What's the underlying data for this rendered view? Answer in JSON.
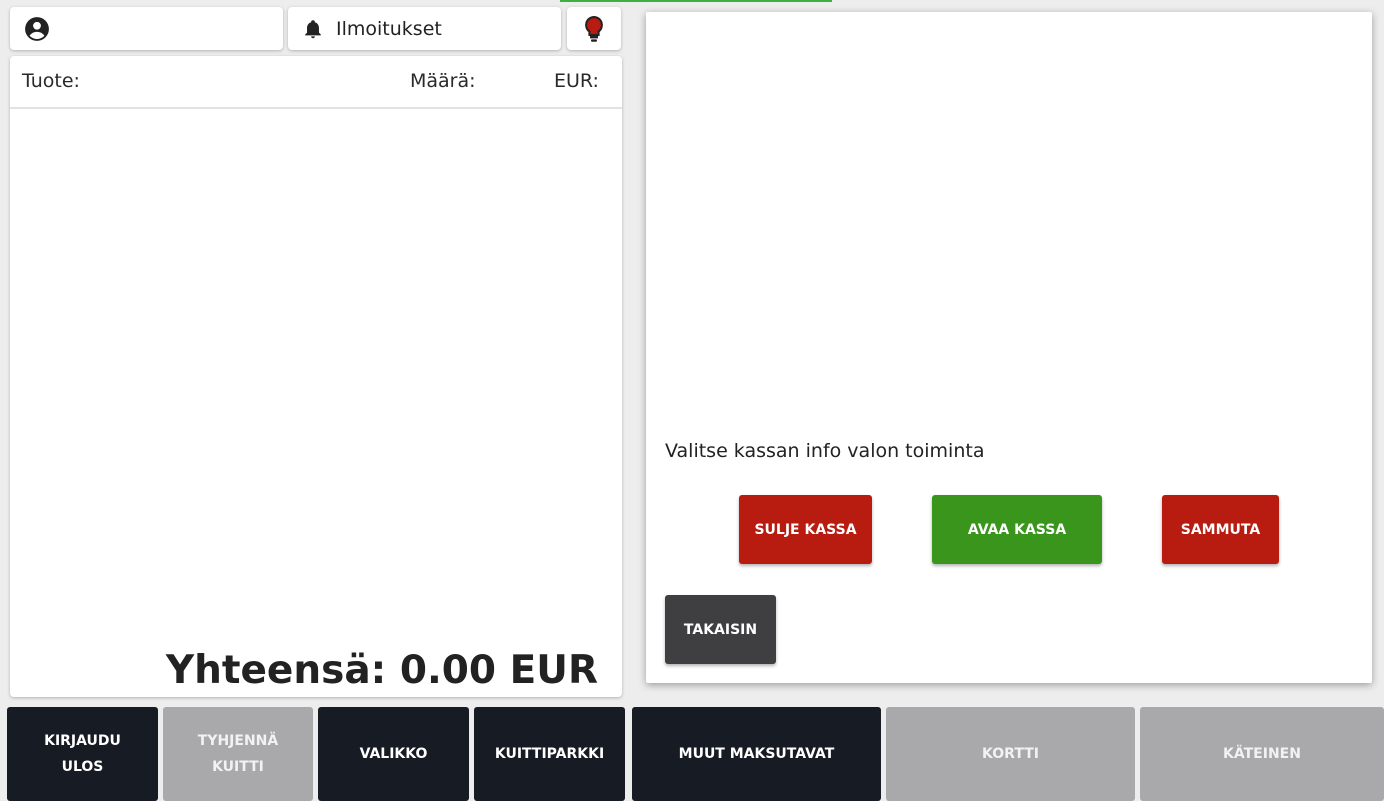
{
  "topbar": {
    "notifications_label": "Ilmoitukset"
  },
  "receipt": {
    "columns": {
      "product": "Tuote:",
      "quantity": "Määrä:",
      "eur": "EUR:"
    },
    "total": "Yhteensä: 0.00 EUR"
  },
  "dialog": {
    "text": "Valitse kassan info valon toiminta",
    "buttons": {
      "close": "SULJE KASSA",
      "open": "AVAA KASSA",
      "shutdown": "SAMMUTA",
      "back": "TAKAISIN"
    }
  },
  "bottom_bar": {
    "logout_line1": "KIRJAUDU",
    "logout_line2": "ULOS",
    "clear_line1": "TYHJENNÄ",
    "clear_line2": "KUITTI",
    "menu": "VALIKKO",
    "receipt_park": "KUITTIPARKKI",
    "other_payments": "MUUT MAKSUTAVAT",
    "card": "KORTTI",
    "cash": "KÄTEINEN"
  },
  "icons": {
    "user": "account-circle-icon",
    "notifications": "bell-icon",
    "info_light": "lightbulb-icon"
  },
  "colors": {
    "red": "#b81b0f",
    "green": "#3a951c",
    "dark": "#171b23",
    "disabled": "#a9a9ab",
    "back": "#3f3f41"
  }
}
